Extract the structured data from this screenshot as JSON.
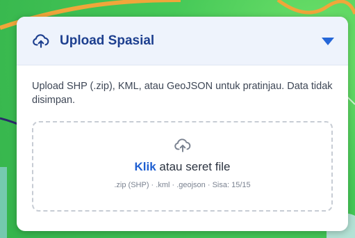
{
  "panel": {
    "title": "Upload Spasial",
    "header_icon": "cloud-upload-icon",
    "toggle_icon": "caret-down-icon",
    "description": "Upload SHP (.zip), KML, atau GeoJSON untuk pratinjau. Data tidak disimpan."
  },
  "dropzone": {
    "icon": "cloud-upload-icon",
    "link_text": "Klik",
    "rest_text": " atau seret file",
    "hint": ".zip (SHP) · .kml · .geojson · Sisa: 15/15"
  },
  "colors": {
    "accent": "#1f5fd1",
    "title": "#1d3f8f",
    "header_bg": "#eef3fc",
    "map_green": "#46c958"
  }
}
